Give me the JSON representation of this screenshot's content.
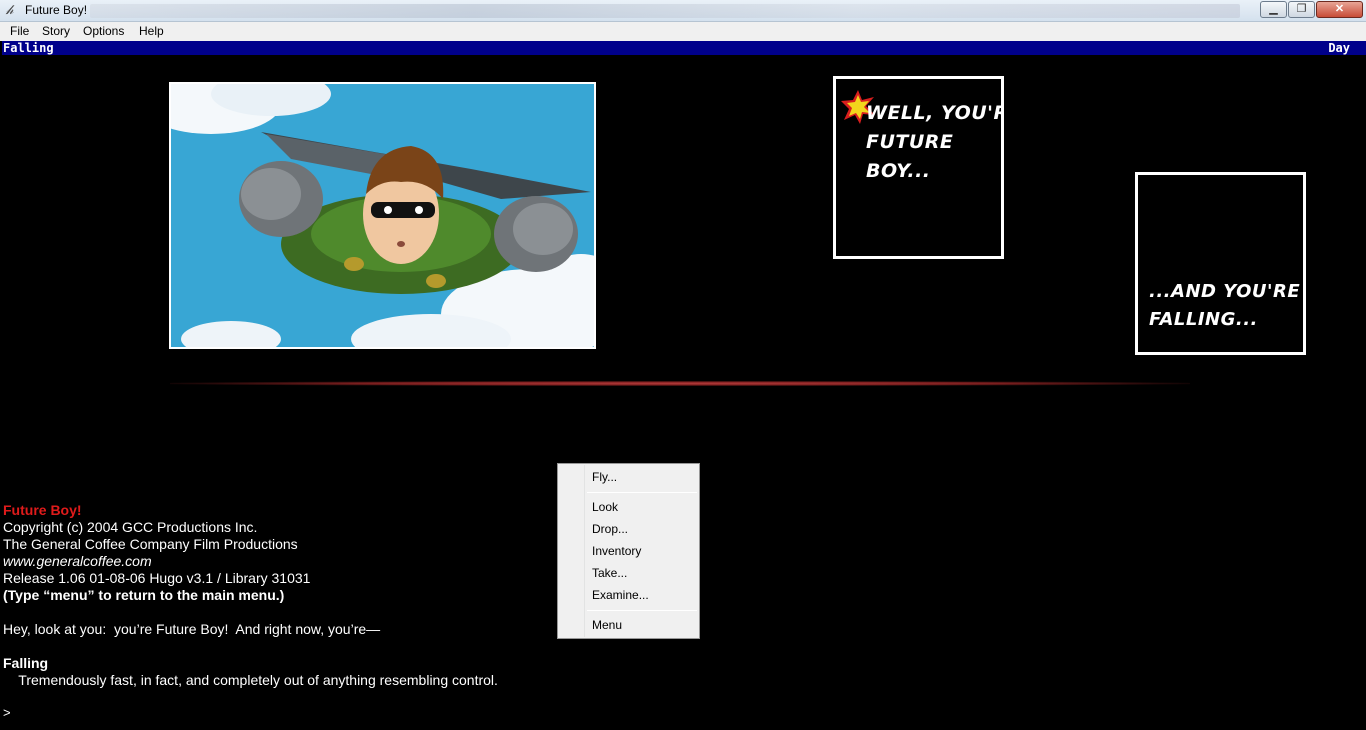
{
  "window": {
    "title": "Future Boy!"
  },
  "menubar": {
    "items": [
      "File",
      "Story",
      "Options",
      "Help"
    ]
  },
  "statusbar": {
    "location": "Falling",
    "time": "Day"
  },
  "panels": {
    "first": [
      "WELL, YOU'RE",
      "FUTURE",
      "BOY..."
    ],
    "second": [
      "...AND YOU'RE",
      "FALLING..."
    ]
  },
  "transcript": {
    "game_title": "Future Boy!",
    "copyright": "Copyright (c) 2004 GCC Productions Inc.",
    "company": "The General Coffee Company Film Productions",
    "website": "www.generalcoffee.com",
    "release": "Release 1.06 01-08-06 Hugo v3.1 / Library 31031",
    "menu_hint": "(Type “menu” to return to the main menu.)",
    "intro": "Hey, look at you:  you’re Future Boy!  And right now, you’re—",
    "room_name": "Falling",
    "room_description": "    Tremendously fast, in fact, and completely out of anything resembling control.",
    "prompt": ">"
  },
  "context_menu": {
    "items": [
      "Fly...",
      "Look",
      "Drop...",
      "Inventory",
      "Take...",
      "Examine...",
      "Menu"
    ]
  }
}
